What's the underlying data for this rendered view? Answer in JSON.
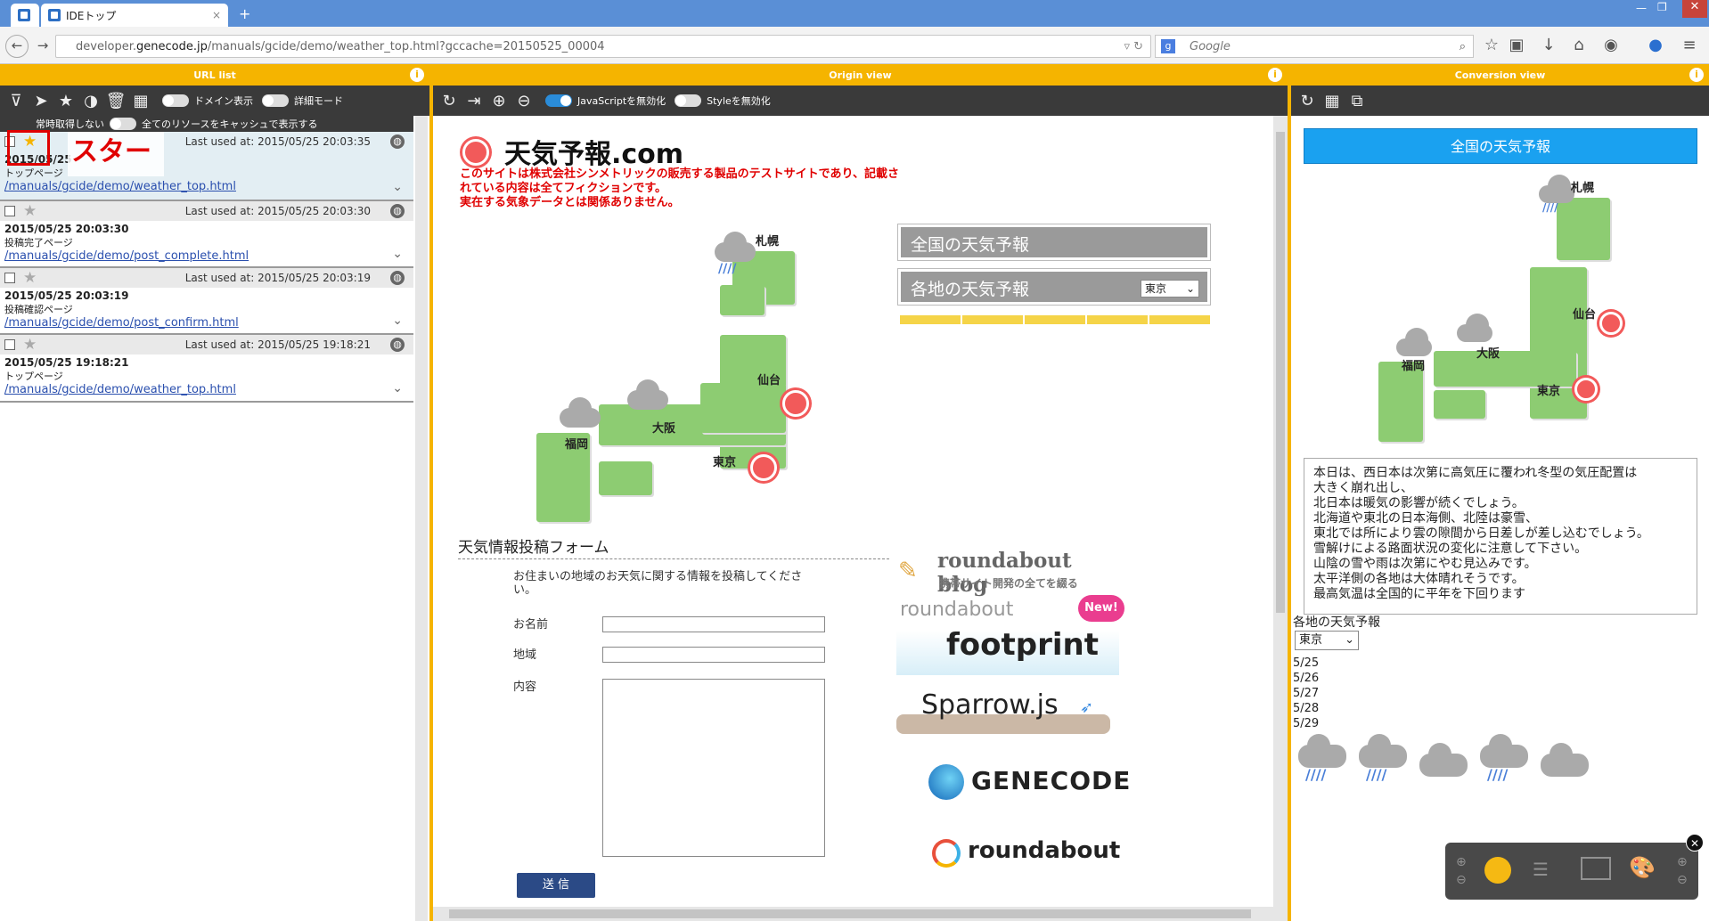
{
  "browser": {
    "tabs": [
      {
        "title": ""
      },
      {
        "title": "IDEトップ"
      }
    ],
    "url_prefix": "developer.",
    "url_domain": "genecode.jp",
    "url_path": "/manuals/gcide/demo/weather_top.html?gccache=20150525_00004",
    "search_placeholder": "Google"
  },
  "panels": {
    "url_list": "URL list",
    "origin_view": "Origin view",
    "conversion_view": "Conversion view"
  },
  "left_toolbar": {
    "domain_toggle": "ドメイン表示",
    "detail_toggle": "詳細モード",
    "cache_line_a": "常時取得しない",
    "cache_line_b": "全てのリソースをキャッシュで表示する"
  },
  "annotation": {
    "label": "スター"
  },
  "url_items": [
    {
      "last_used": "Last used at: 2015/05/25 20:03:35",
      "datetime": "2015/05/25",
      "page": "トップページ",
      "path": "/manuals/gcide/demo/weather_top.html",
      "starred": true
    },
    {
      "last_used": "Last used at: 2015/05/25 20:03:30",
      "datetime": "2015/05/25 20:03:30",
      "page": "投稿完了ページ",
      "path": "/manuals/gcide/demo/post_complete.html",
      "starred": false
    },
    {
      "last_used": "Last used at: 2015/05/25 20:03:19",
      "datetime": "2015/05/25 20:03:19",
      "page": "投稿確認ページ",
      "path": "/manuals/gcide/demo/post_confirm.html",
      "starred": false
    },
    {
      "last_used": "Last used at: 2015/05/25 19:18:21",
      "datetime": "2015/05/25 19:18:21",
      "page": "トップページ",
      "path": "/manuals/gcide/demo/weather_top.html",
      "starred": false
    }
  ],
  "origin_toolbar": {
    "js_toggle": "JavaScriptを無効化",
    "style_toggle": "Styleを無効化"
  },
  "site": {
    "title": "天気予報",
    "title_suffix": ".com",
    "disclaimer_1": "このサイトは株式会社シンメトリックの販売する製品のテストサイトであり、記載さ",
    "disclaimer_2": "れている内容は全てフィクションです。",
    "disclaimer_3": "実在する気象データとは関係ありません。",
    "cities": {
      "sapporo": "札幌",
      "sendai": "仙台",
      "osaka": "大阪",
      "fukuoka": "福岡",
      "tokyo": "東京"
    },
    "nav_national": "全国の天気予報",
    "nav_regional": "各地の天気予報",
    "region_select": "東京",
    "form_title": "天気情報投稿フォーム",
    "form_intro": "お住まいの地域のお天気に関する情報を投稿してください。",
    "form_intro_1": "お住まいの地域のお天気に関する情報を投稿してくださ",
    "form_intro_2": "い。",
    "label_name": "お名前",
    "label_region": "地域",
    "label_content": "内容",
    "submit": "送 信",
    "banners": {
      "rb_blog": "roundabout blog",
      "rb_blog_sub": "携帯サイト開発の全てを綴る",
      "rb_footprint_a": "roundabout",
      "rb_footprint_new": "New!",
      "rb_footprint_b": "footprint",
      "sparrow": "Sparrow.js",
      "genecode": "GENECODE",
      "roundabout": "roundabout"
    }
  },
  "conversion": {
    "header_button": "全国の天気予報",
    "forecast_text": "本日は、西日本は次第に高気圧に覆われ冬型の気圧配置は大きく崩れ出し、北日本は暖気の影響が続くでしょう。北海道や東北の日本海側、北陸は豪雪、東北では所により雲の隙間から日差しが差し込むでしょう。雪解けによる路面状況の変化に注意して下さい。山陰の雪や雨は次第にやむ見込みです。太平洋側の各地は大体晴れそうです。最高気温は全国的に平年を下回ります",
    "forecast_lines": [
      "本日は、西日本は次第に高気圧に覆われ冬型の気圧配置は",
      "大きく崩れ出し、",
      "北日本は暖気の影響が続くでしょう。",
      "北海道や東北の日本海側、北陸は豪雪、",
      "東北では所により雲の隙間から日差しが差し込むでしょう。",
      "雪解けによる路面状況の変化に注意して下さい。",
      "山陰の雪や雨は次第にやむ見込みです。",
      "太平洋側の各地は大体晴れそうです。",
      "最高気温は全国的に平年を下回ります"
    ],
    "regional_label": "各地の天気予報",
    "region_select": "東京",
    "dates": [
      "5/25",
      "5/26",
      "5/27",
      "5/28",
      "5/29"
    ]
  },
  "colors": {
    "accent": "#f5b400",
    "toolbar": "#3a3a3a",
    "land": "#8dcc72",
    "sun": "#f25a5a",
    "blue_button": "#1aa1f0",
    "navy_button": "#2b4a86"
  }
}
